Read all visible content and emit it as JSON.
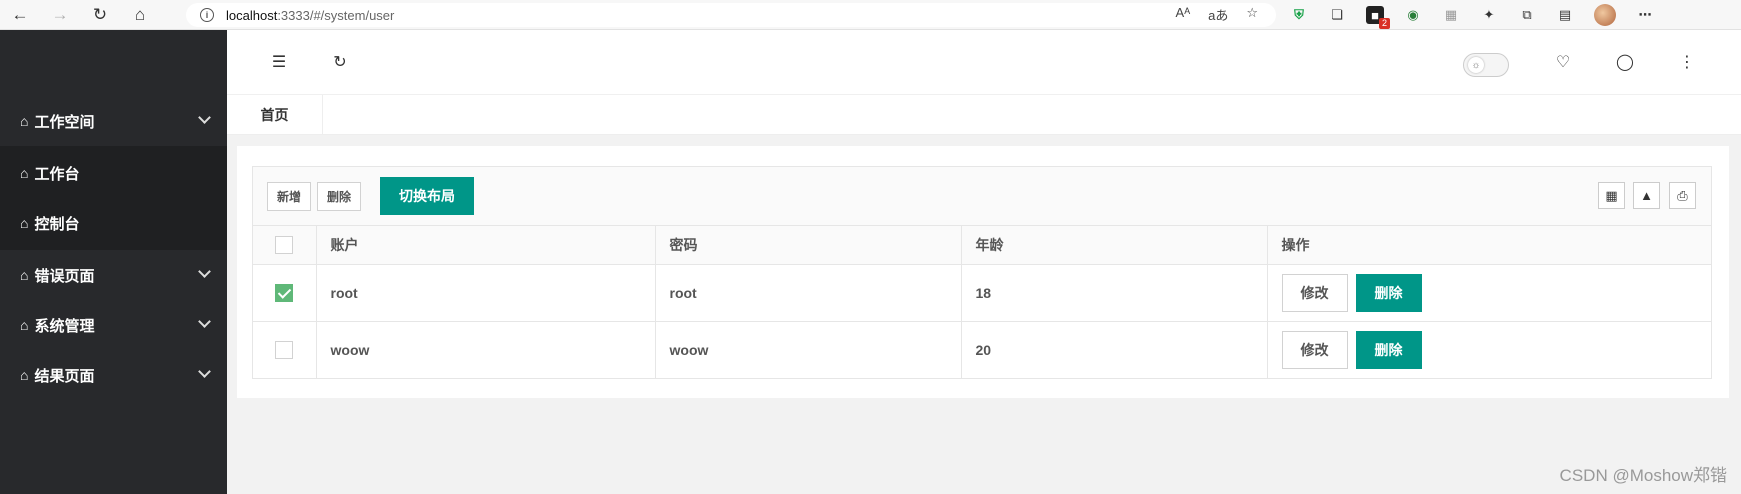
{
  "browser": {
    "url_host": "localhost",
    "url_rest": ":3333/#/system/user",
    "info_glyph": "i",
    "read_aloud": "Aᴬ",
    "translate": "aあ",
    "ext_badge": "2"
  },
  "sidebar": {
    "menu": [
      {
        "label": "工作空间",
        "expanded": true,
        "children": [
          {
            "label": "工作台"
          },
          {
            "label": "控制台"
          }
        ]
      },
      {
        "label": "错误页面",
        "expanded": false
      },
      {
        "label": "系统管理",
        "expanded": false
      },
      {
        "label": "结果页面",
        "expanded": false
      }
    ]
  },
  "header": {
    "icons": [
      "menu-fold-icon",
      "refresh-icon",
      "theme-toggle",
      "bell-icon",
      "user-icon",
      "more-icon"
    ]
  },
  "tabs": {
    "home": "首页"
  },
  "toolbar": {
    "add": "新增",
    "delete": "删除",
    "switch_layout": "切换布局",
    "right_icons": [
      "columns-icon",
      "export-icon",
      "print-icon"
    ]
  },
  "table": {
    "columns": [
      "账户",
      "密码",
      "年龄",
      "操作"
    ],
    "rows": [
      {
        "checked": true,
        "account": "root",
        "password": "root",
        "age": "18",
        "edit": "修改",
        "del": "删除"
      },
      {
        "checked": false,
        "account": "woow",
        "password": "woow",
        "age": "20",
        "edit": "修改",
        "del": "删除"
      }
    ]
  },
  "watermark": "CSDN @Moshow郑锴",
  "colors": {
    "sidebar_bg": "#28292c",
    "primary": "#009688",
    "checkbox_checked": "#5fb878"
  }
}
